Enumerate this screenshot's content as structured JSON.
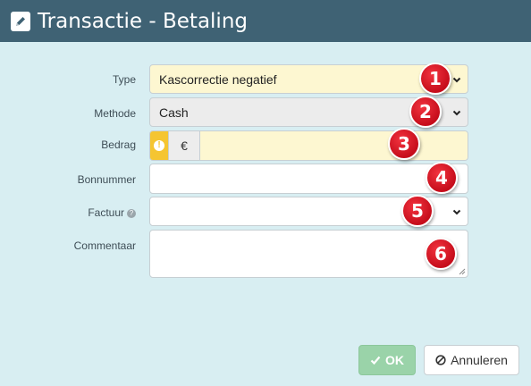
{
  "dialog": {
    "title": "Transactie - Betaling"
  },
  "form": {
    "type_label": "Type",
    "type_value": "Kascorrectie negatief",
    "method_label": "Methode",
    "method_value": "Cash",
    "amount_label": "Bedrag",
    "currency_symbol": "€",
    "amount_value": "",
    "receipt_label": "Bonnummer",
    "receipt_value": "",
    "invoice_label": "Factuur",
    "invoice_value": "",
    "comment_label": "Commentaar",
    "comment_value": ""
  },
  "markers": [
    "1",
    "2",
    "3",
    "4",
    "5",
    "6"
  ],
  "buttons": {
    "ok_label": "OK",
    "cancel_label": "Annuleren"
  },
  "colors": {
    "titlebar": "#3f6274",
    "background": "#d8eef2",
    "required_field": "#fdf7d1",
    "warning": "#f5c531",
    "ok_button": "#9ad3a9",
    "marker": "#d8121f"
  },
  "icons": {
    "title": "pencil-square-icon",
    "warning": "exclamation-circle-icon",
    "help": "question-circle-icon",
    "ok": "check-icon",
    "cancel": "ban-icon"
  }
}
